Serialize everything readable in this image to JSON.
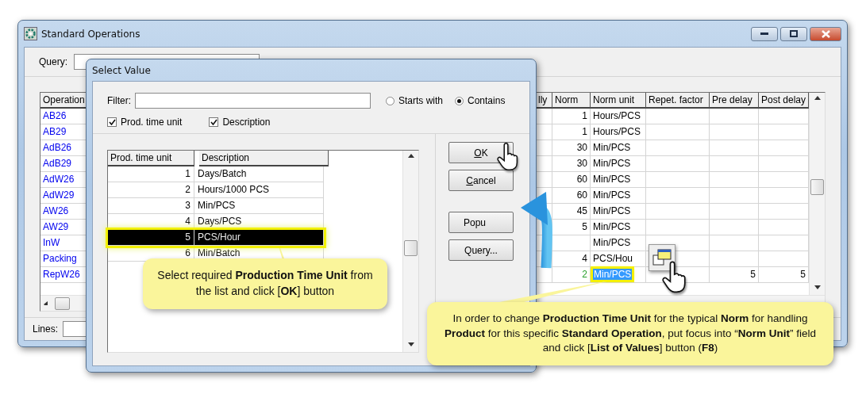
{
  "main_window": {
    "title": "Standard Operations",
    "query_label": "Query:",
    "grid": {
      "operation_header": "Operation",
      "columns": [
        {
          "label": "lly"
        },
        {
          "label": "Norm"
        },
        {
          "label": "Norm unit"
        },
        {
          "label": "Repet. factor"
        },
        {
          "label": "Pre delay"
        },
        {
          "label": "Post delay"
        }
      ],
      "rows": [
        {
          "operation": "AB26",
          "norm": "1",
          "norm_unit": "Hours/PCS",
          "selected": false
        },
        {
          "operation": "AB29",
          "norm": "1",
          "norm_unit": "Hours/PCS",
          "selected": false
        },
        {
          "operation": "AdB26",
          "norm": "30",
          "norm_unit": "Min/PCS",
          "selected": false
        },
        {
          "operation": "AdB29",
          "norm": "30",
          "norm_unit": "Min/PCS",
          "selected": false
        },
        {
          "operation": "AdW26",
          "norm": "60",
          "norm_unit": "Min/PCS",
          "selected": false
        },
        {
          "operation": "AdW29",
          "norm": "60",
          "norm_unit": "Min/PCS",
          "selected": false
        },
        {
          "operation": "AW26",
          "norm": "45",
          "norm_unit": "Min/PCS",
          "selected": false
        },
        {
          "operation": "AW29",
          "norm": "5",
          "norm_unit": "Min/PCS",
          "selected": false
        },
        {
          "operation": "InW",
          "norm_unit": "Min/PCS",
          "selected": false
        },
        {
          "operation": "Packing",
          "norm": "4",
          "norm_unit": "PCS/Hou",
          "selected": false
        },
        {
          "operation": "RepW26",
          "norm": "2",
          "norm_unit": "Min/PCS",
          "pre_delay": "5",
          "post_delay": "5",
          "selected": true
        }
      ]
    },
    "lines_label": "Lines:"
  },
  "dialog": {
    "title": "Select Value",
    "filter_label": "Filter:",
    "match_options": [
      {
        "label": "Starts with",
        "selected": false
      },
      {
        "label": "Contains",
        "selected": true
      }
    ],
    "search_columns": [
      {
        "label": "Prod. time unit",
        "checked": true
      },
      {
        "label": "Description",
        "checked": true
      }
    ],
    "list": {
      "columns": [
        "Prod. time unit",
        "Description"
      ],
      "rows": [
        {
          "unit": "1",
          "description": "Days/Batch",
          "selected": false
        },
        {
          "unit": "2",
          "description": "Hours/1000 PCS",
          "selected": false
        },
        {
          "unit": "3",
          "description": "Min/PCS",
          "selected": false
        },
        {
          "unit": "4",
          "description": "Days/PCS",
          "selected": false
        },
        {
          "unit": "5",
          "description": "PCS/Hour",
          "selected": true
        },
        {
          "unit": "6",
          "description": "Min/Batch",
          "selected": false
        }
      ]
    },
    "buttons": [
      {
        "label": "OK",
        "mnemonic": true
      },
      {
        "label": "Cancel",
        "mnemonic": true
      },
      {
        "label": "Popu",
        "mnemonic": false
      },
      {
        "label": "Query...",
        "mnemonic": false
      }
    ]
  },
  "callouts": [
    {
      "text": "Select required **Production Time Unit** from the list and click [**OK**] button"
    },
    {
      "text": "In order to change **Production Time Unit** for the typical **Norm** for handling **Product** for this specific **Standard Operation**, put focus into “**Norm Unit**” field and click [**List of Values**] button (**F8**)"
    }
  ]
}
